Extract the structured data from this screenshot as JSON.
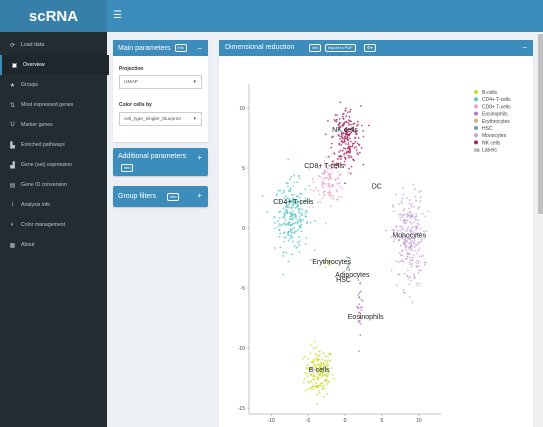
{
  "app": {
    "title": "scRNA"
  },
  "sidebar": {
    "items": [
      {
        "label": "Load data",
        "icon": "upload-icon",
        "glyph": "⟳"
      },
      {
        "label": "Overview",
        "icon": "binoculars-icon",
        "glyph": "▣"
      },
      {
        "label": "Groups",
        "icon": "star-icon",
        "glyph": "★"
      },
      {
        "label": "Most expressed genes",
        "icon": "sort-icon",
        "glyph": "⇅"
      },
      {
        "label": "Marker genes",
        "icon": "magnet-icon",
        "glyph": "U"
      },
      {
        "label": "Enriched pathways",
        "icon": "bar-chart-icon",
        "glyph": "▙"
      },
      {
        "label": "Gene (set) expression",
        "icon": "line-chart-icon",
        "glyph": "▟"
      },
      {
        "label": "Gene ID conversion",
        "icon": "list-icon",
        "glyph": "▤"
      },
      {
        "label": "Analysis info",
        "icon": "info-icon",
        "glyph": "i"
      },
      {
        "label": "Color management",
        "icon": "palette-icon",
        "glyph": "◐"
      },
      {
        "label": "About",
        "icon": "id-card-icon",
        "glyph": "▦"
      }
    ],
    "active_index": 1
  },
  "main_params": {
    "title": "Main parameters",
    "info_label": "info",
    "projection_label": "Projection",
    "projection_value": "UMAP",
    "color_by_label": "Color cells by",
    "color_by_value": "cell_type_singler_blueprint"
  },
  "additional_params": {
    "title": "Additional parameters",
    "info_label": "info"
  },
  "group_filters": {
    "title": "Group filters",
    "info_label": "info"
  },
  "dimred": {
    "title": "Dimensional reduction",
    "info_label": "info",
    "export_label": "export to PDF"
  },
  "colors": {
    "accent": "#3c8dbc",
    "sidebar": "#222d32",
    "b_cells": "#c8dd2a",
    "cd4_tcells": "#5cc8c4",
    "cd8_tcells": "#e8a7c6",
    "eosinophils": "#b07fbd",
    "erythrocytes": "#c7b86f",
    "hsc": "#7aa0a8",
    "monocytes": "#c9a3d6",
    "nk_cells": "#a8265c"
  },
  "chart_data": {
    "type": "scatter",
    "xlabel": "",
    "ylabel": "",
    "xlim": [
      -13,
      13
    ],
    "ylim": [
      -15.5,
      12
    ],
    "x_ticks": [
      "-10",
      "-5",
      "0",
      "5",
      "10"
    ],
    "y_ticks": [
      "10",
      "5",
      "0",
      "-5",
      "-10",
      "-15"
    ],
    "legend": {
      "position": "right",
      "entries": [
        {
          "name": "B-cells",
          "color": "#c8dd2a"
        },
        {
          "name": "CD4+ T-cells",
          "color": "#5cc8c4"
        },
        {
          "name": "CD8+ T-cells",
          "color": "#e8a7c6"
        },
        {
          "name": "Eosinophils",
          "color": "#b07fbd"
        },
        {
          "name": "Erythrocytes",
          "color": "#c7b86f"
        },
        {
          "name": "HSC",
          "color": "#7aa0a8"
        },
        {
          "name": "Monocytes",
          "color": "#c9a3d6"
        },
        {
          "name": "NK cells",
          "color": "#a8265c"
        },
        {
          "name": "Labels",
          "color": "#333333"
        }
      ]
    },
    "clusters": [
      {
        "name": "B-cells",
        "color": "#c8dd2a",
        "cx": -3.5,
        "cy": -12,
        "sx": 1.6,
        "sy": 1.7,
        "n": 170
      },
      {
        "name": "CD4+ T-cells",
        "color": "#5cc8c4",
        "cx": -7.2,
        "cy": 1.0,
        "sx": 1.9,
        "sy": 2.4,
        "n": 240
      },
      {
        "name": "CD8+ T-cells",
        "color": "#e8a7c6",
        "cx": -2.0,
        "cy": 4.0,
        "sx": 1.7,
        "sy": 1.5,
        "n": 120
      },
      {
        "name": "NK cells",
        "color": "#a8265c",
        "cx": 0.2,
        "cy": 7.5,
        "sx": 1.6,
        "sy": 2.2,
        "n": 200
      },
      {
        "name": "Monocytes",
        "color": "#c9a3d6",
        "cx": 8.6,
        "cy": -1.0,
        "sx": 1.7,
        "sy": 3.3,
        "n": 260
      },
      {
        "name": "Eosinophils",
        "color": "#b07fbd",
        "cx": 2.0,
        "cy": -6.5,
        "sx": 0.4,
        "sy": 2.0,
        "n": 30
      },
      {
        "name": "Erythrocytes",
        "color": "#c7b86f",
        "cx": -2.5,
        "cy": -2.8,
        "sx": 0.5,
        "sy": 0.3,
        "n": 10
      },
      {
        "name": "HSC",
        "color": "#7aa0a8",
        "cx": 0.5,
        "cy": -3.2,
        "sx": 0.2,
        "sy": 0.8,
        "n": 12
      }
    ],
    "labels": [
      {
        "text": "NK cells",
        "x": 0.0,
        "y": 8.0
      },
      {
        "text": "CD8+ T-cells",
        "x": -2.8,
        "y": 5.0
      },
      {
        "text": "CD4+ T-cells",
        "x": -7.0,
        "y": 2.0
      },
      {
        "text": "DC",
        "x": 4.3,
        "y": 3.3
      },
      {
        "text": "Monocytes",
        "x": 8.7,
        "y": -0.8
      },
      {
        "text": "Erythrocytes",
        "x": -1.8,
        "y": -3.0
      },
      {
        "text": "Adipocytes",
        "x": 1.0,
        "y": -4.1
      },
      {
        "text": "HSC",
        "x": -0.2,
        "y": -4.5
      },
      {
        "text": "Eosinophils",
        "x": 2.8,
        "y": -7.6
      },
      {
        "text": "B-cells",
        "x": -3.5,
        "y": -12.0
      }
    ]
  }
}
